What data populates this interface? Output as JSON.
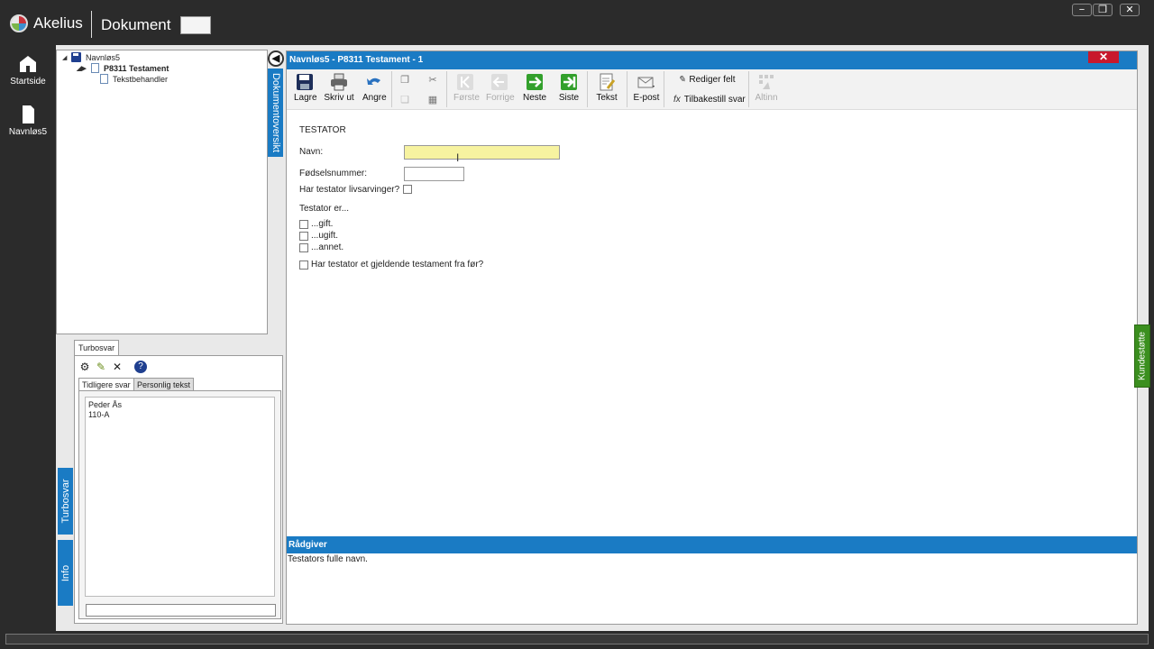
{
  "app": {
    "name": "Akelius",
    "section_title": "Dokument",
    "title_box": ""
  },
  "window_controls": {
    "minimize": "−",
    "restore": "❐",
    "close": "✕"
  },
  "rail": {
    "items": [
      {
        "label": "Startside",
        "icon": "home-icon"
      },
      {
        "label": "Navnløs5",
        "icon": "document-icon"
      }
    ]
  },
  "tree": {
    "root": "Navnløs5",
    "child": "P8311 Testament",
    "grandchild": "Tekstbehandler"
  },
  "side_tabs": {
    "document_overview": "Dokumentoversikt",
    "turbosvar": "Turbosvar",
    "info": "Info",
    "support": "Kundestøtte"
  },
  "turbosvar": {
    "tab_label": "Turbosvar",
    "subtabs": [
      "Tidligere svar",
      "Personlig tekst"
    ],
    "answers": [
      "Peder Ås",
      "110-A"
    ],
    "input_value": ""
  },
  "document": {
    "window_title": "Navnløs5 - P8311 Testament - 1",
    "close_label": "✕",
    "toolbar": {
      "save": "Lagre",
      "print": "Skriv ut",
      "undo": "Angre",
      "first": "Første",
      "previous": "Forrige",
      "next": "Neste",
      "last": "Siste",
      "text": "Tekst",
      "email": "E-post",
      "edit_field": "Rediger felt",
      "reset_answer": "Tilbakestill svar",
      "altinn": "Altinn"
    },
    "form": {
      "section_title": "TESTATOR",
      "name_label": "Navn:",
      "name_value": "",
      "birth_number_label": "Fødselsnummer:",
      "birth_number_value": "",
      "heirs_question": "Har testator livsarvinger?",
      "status_title": "Testator er...",
      "status_options": [
        "...gift.",
        "...ugift.",
        "...annet."
      ],
      "prior_will_question": "Har testator et gjeldende testament fra før?"
    },
    "advisor": {
      "title": "Rådgiver",
      "text": "Testators fulle navn."
    }
  },
  "colors": {
    "accent_blue": "#1a7bc4",
    "close_red": "#c8182c",
    "active_field_yellow": "#f7f3a0",
    "support_green": "#3b8f1f"
  }
}
